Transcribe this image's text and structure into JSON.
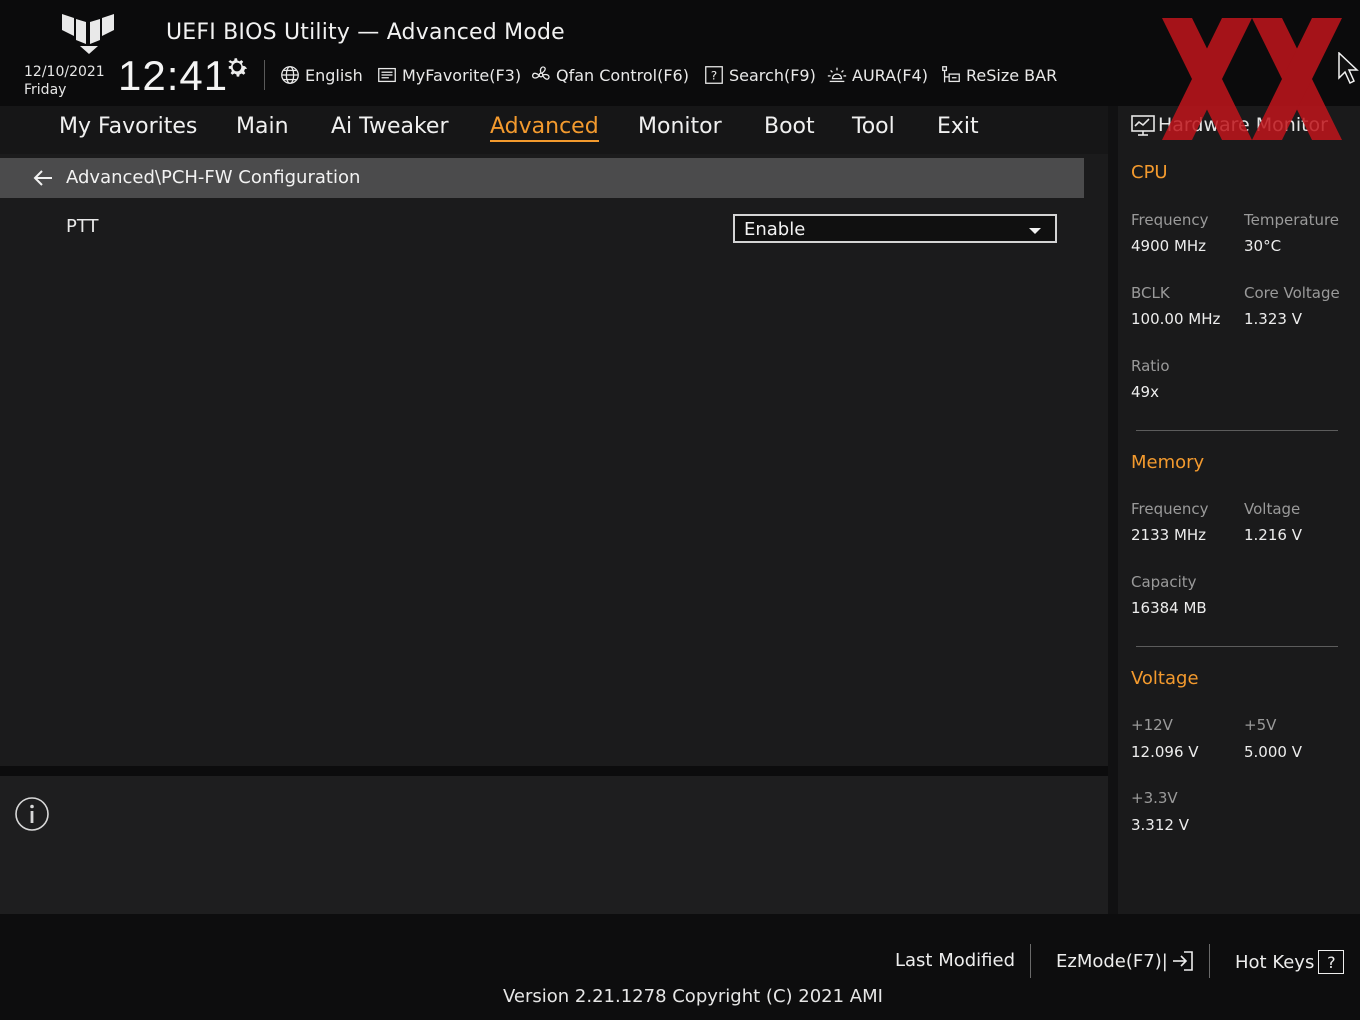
{
  "header": {
    "title": "UEFI BIOS Utility — Advanced Mode",
    "date": "12/10/2021",
    "day": "Friday",
    "time": "12:41",
    "tools": [
      {
        "label": "English",
        "icon": "globe-icon"
      },
      {
        "label": "MyFavorite(F3)",
        "icon": "favorite-list-icon"
      },
      {
        "label": "Qfan Control(F6)",
        "icon": "fan-icon"
      },
      {
        "label": "Search(F9)",
        "icon": "search-help-icon"
      },
      {
        "label": "AURA(F4)",
        "icon": "aura-light-icon"
      },
      {
        "label": "ReSize BAR",
        "icon": "resize-bar-icon"
      }
    ]
  },
  "nav": {
    "tabs": [
      "My Favorites",
      "Main",
      "Ai Tweaker",
      "Advanced",
      "Monitor",
      "Boot",
      "Tool",
      "Exit"
    ],
    "active": "Advanced"
  },
  "main": {
    "breadcrumb": "Advanced\\PCH-FW Configuration",
    "settings": [
      {
        "label": "PTT",
        "value": "Enable"
      }
    ]
  },
  "sidebar": {
    "title": "Hardware Monitor",
    "cpu": {
      "title": "CPU",
      "frequency_label": "Frequency",
      "frequency": "4900 MHz",
      "temperature_label": "Temperature",
      "temperature": "30°C",
      "bclk_label": "BCLK",
      "bclk": "100.00 MHz",
      "core_voltage_label": "Core Voltage",
      "core_voltage": "1.323 V",
      "ratio_label": "Ratio",
      "ratio": "49x"
    },
    "memory": {
      "title": "Memory",
      "frequency_label": "Frequency",
      "frequency": "2133 MHz",
      "voltage_label": "Voltage",
      "voltage": "1.216 V",
      "capacity_label": "Capacity",
      "capacity": "16384 MB"
    },
    "voltage": {
      "title": "Voltage",
      "v12_label": "+12V",
      "v12": "12.096 V",
      "v5_label": "+5V",
      "v5": "5.000 V",
      "v33_label": "+3.3V",
      "v33": "3.312 V"
    }
  },
  "footer": {
    "last_modified": "Last Modified",
    "ezmode": "EzMode(F7)|",
    "hotkeys": "Hot Keys",
    "hotkeys_glyph": "?",
    "version": "Version 2.21.1278 Copyright (C) 2021 AMI"
  },
  "colors": {
    "accent": "#f39a2e",
    "background": "#111112",
    "breadcrumb_bar": "#4b4b4c"
  }
}
